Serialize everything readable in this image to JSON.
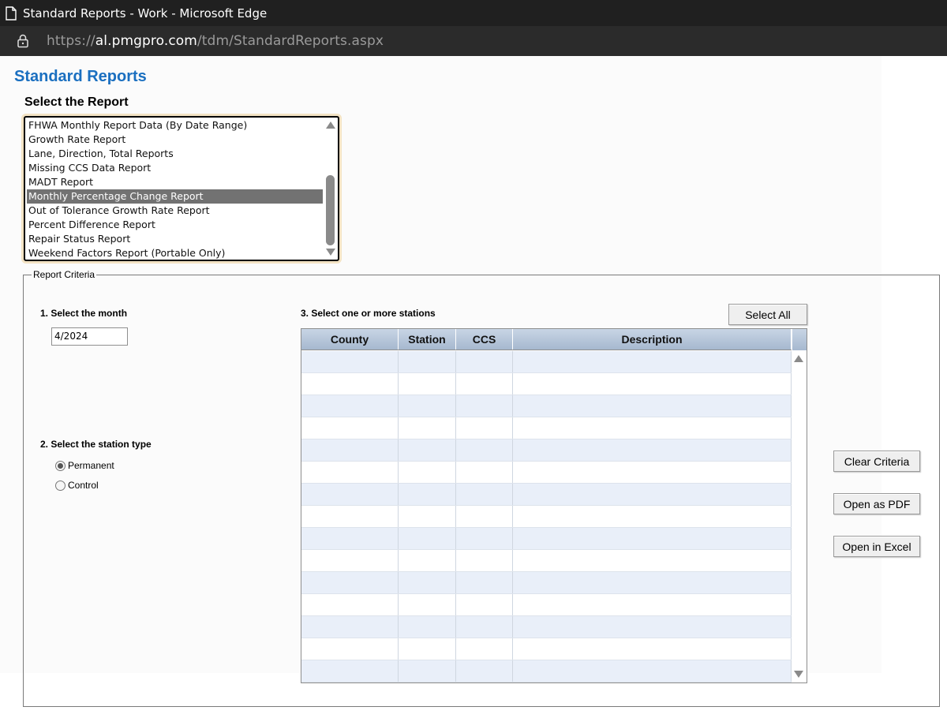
{
  "browser": {
    "window_title": "Standard Reports - Work - Microsoft Edge",
    "url_scheme": "https://",
    "url_host": "al.pmgpro.com",
    "url_path": "/tdm/StandardReports.aspx"
  },
  "page": {
    "title": "Standard Reports",
    "select_report_heading": "Select the Report"
  },
  "report_list": {
    "items": [
      "FHWA Monthly Report Data (By Date Range)",
      "Growth Rate Report",
      "Lane, Direction, Total Reports",
      "Missing CCS Data Report",
      "MADT Report",
      "Monthly Percentage Change Report",
      "Out of Tolerance Growth Rate Report",
      "Percent Difference Report",
      "Repair Status Report",
      "Weekend Factors Report (Portable Only)"
    ],
    "selected": "Monthly Percentage Change Report"
  },
  "criteria": {
    "legend": "Report Criteria",
    "step1_label": "1. Select the month",
    "month_value": "4/2024",
    "step2_label": "2. Select the station type",
    "station_types": [
      "Permanent",
      "Control"
    ],
    "selected_station_type": "Permanent",
    "step3_label": "3. Select one or more stations",
    "select_all_label": "Select All"
  },
  "stations_grid": {
    "columns": [
      "County",
      "Station",
      "CCS",
      "Description"
    ],
    "rows": []
  },
  "actions": {
    "clear_label": "Clear Criteria",
    "pdf_label": "Open as PDF",
    "excel_label": "Open in Excel"
  },
  "colors": {
    "title_blue": "#1a6fc0",
    "selected_item": "#727272",
    "grid_header": "#a6b8cf",
    "grid_alt_row": "#e9eff9"
  }
}
